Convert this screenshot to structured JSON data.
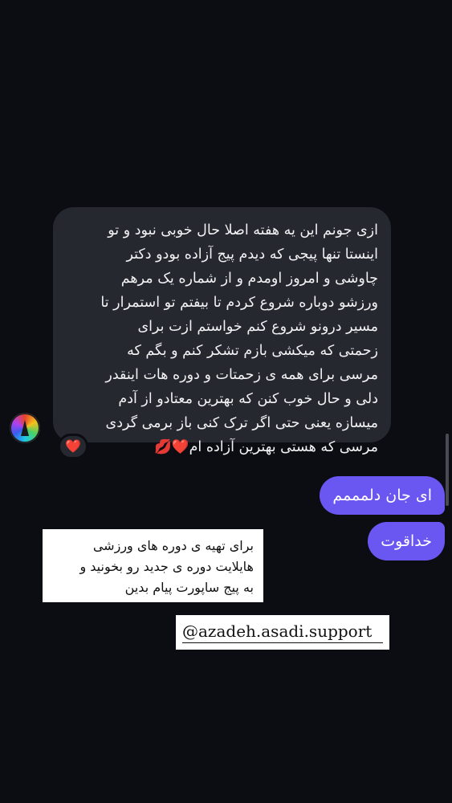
{
  "conversation": {
    "incoming_message": {
      "lines": [
        "ازی جونم این یه هفته اصلا حال خوبی نبود و تو",
        "اینستا تنها پیجی که دیدم پیج آزاده  بودو دکتر",
        "چاوشی و امروز اومدم و از شماره یک مرهم",
        "ورزشو دوباره شروع کردم تا بیفتم تو استمرار تا",
        "مسیر درونو شروع کنم خواستم ازت برای",
        "زحمتی که میکشی بازم تشکر کنم  و بگم  که",
        "مرسی برای همه ی زحمتات و دوره هات اینقدر",
        "دلی و حال خوب کنن که بهترین  معتادو از آدم",
        "میسازه یعنی حتی اگر ترک کنی باز برمی گردی",
        "مرسی که هستی بهترین آزاده ام❤️💋"
      ],
      "reaction": "❤️"
    },
    "outgoing_messages": [
      "ای جان دلمممم",
      "خداقوت"
    ]
  },
  "story_caption": {
    "lines": [
      "برای تهیه ی دوره های ورزشی",
      "هایلایت دوره ی جدید رو بخونید و",
      "به پیج ساپورت پیام بدین"
    ]
  },
  "support_handle": "@azadeh.asadi.support",
  "colors": {
    "background": "#0c0d12",
    "incoming_bubble": "#262830",
    "outgoing_bubble": "#6a57f2",
    "caption_box": "#ffffff"
  }
}
